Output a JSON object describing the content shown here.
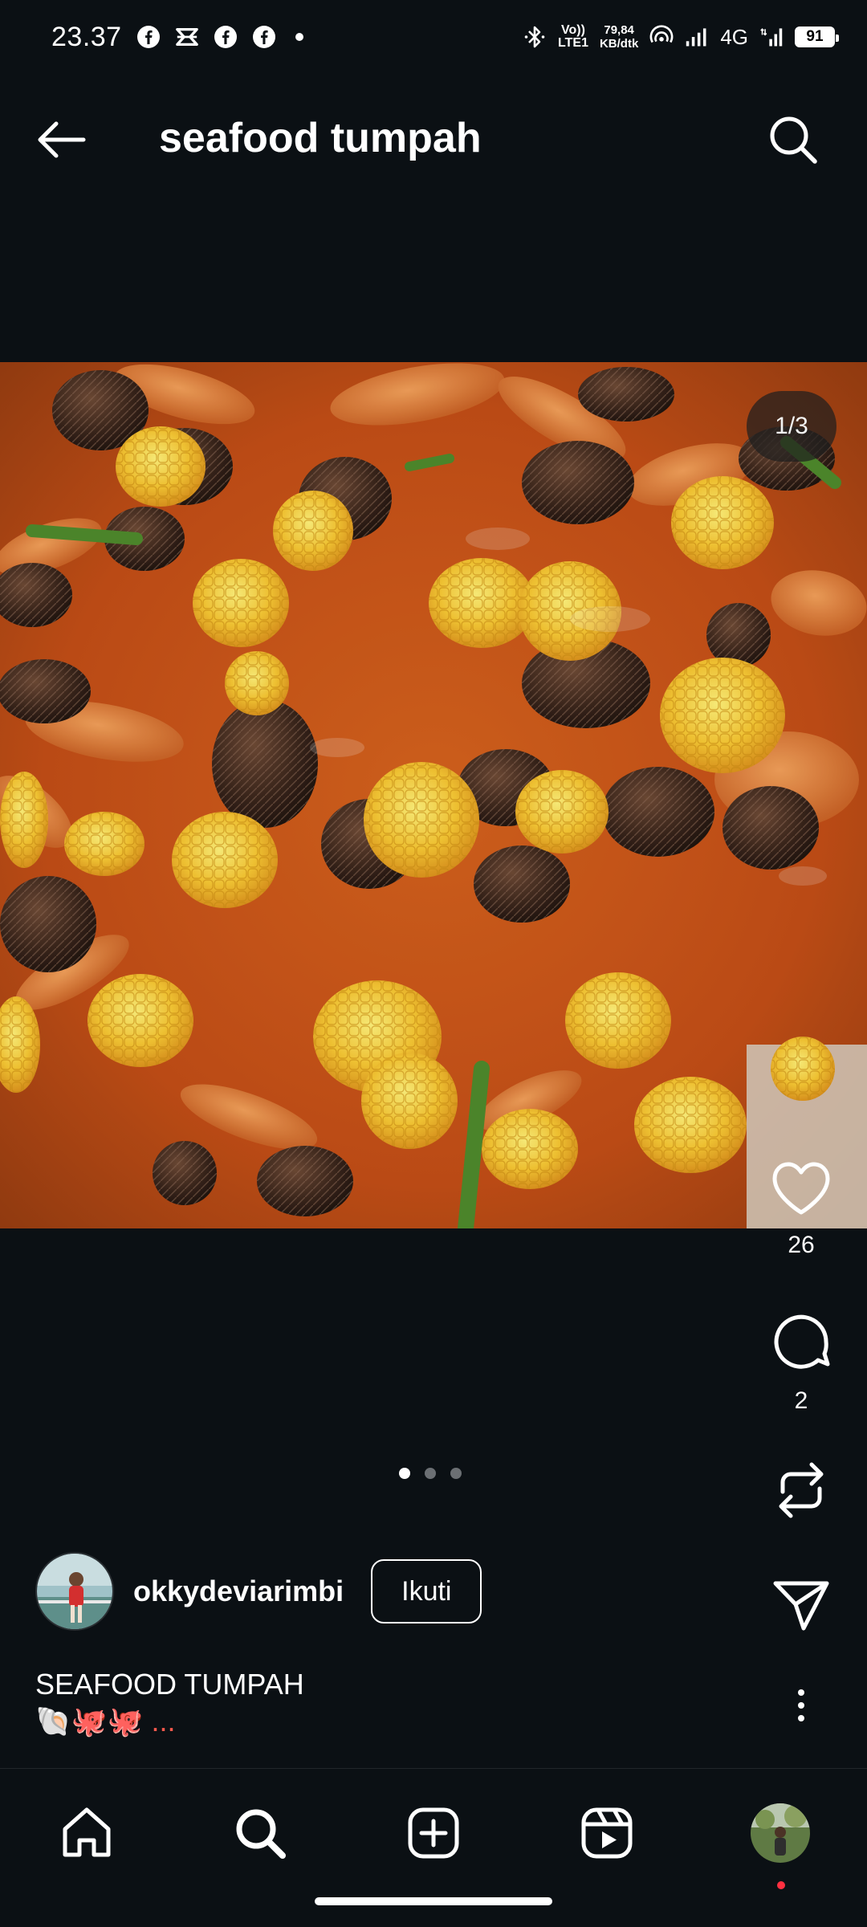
{
  "status_bar": {
    "time": "23.37",
    "volte_top": "Vo))",
    "volte_bottom": "LTE1",
    "net_speed_value": "79,84",
    "net_speed_unit": "KB/dtk",
    "network_type": "4G",
    "battery": "91",
    "notification_icons": [
      "facebook-icon",
      "capcut-icon",
      "facebook-icon",
      "facebook-icon"
    ]
  },
  "header": {
    "title": "seafood tumpah",
    "back_icon": "arrow-left-icon",
    "search_icon": "search-icon"
  },
  "post": {
    "image_counter": "1/3",
    "image_count": 3,
    "active_image_index": 0,
    "likes": "26",
    "comments": "2"
  },
  "author": {
    "username": "okkydeviarimbi",
    "follow_label": "Ikuti"
  },
  "caption": {
    "title": "SEAFOOD TUMPAH",
    "emoji_line": "🐚🐙🐙 ..."
  },
  "bottom_nav": {
    "items": [
      "home-icon",
      "search-icon",
      "create-icon",
      "reels-icon",
      "profile-avatar"
    ],
    "active": "search-icon"
  },
  "colors": {
    "background": "#0b1014",
    "text": "#ffffff",
    "notification_dot": "#ff3040"
  }
}
